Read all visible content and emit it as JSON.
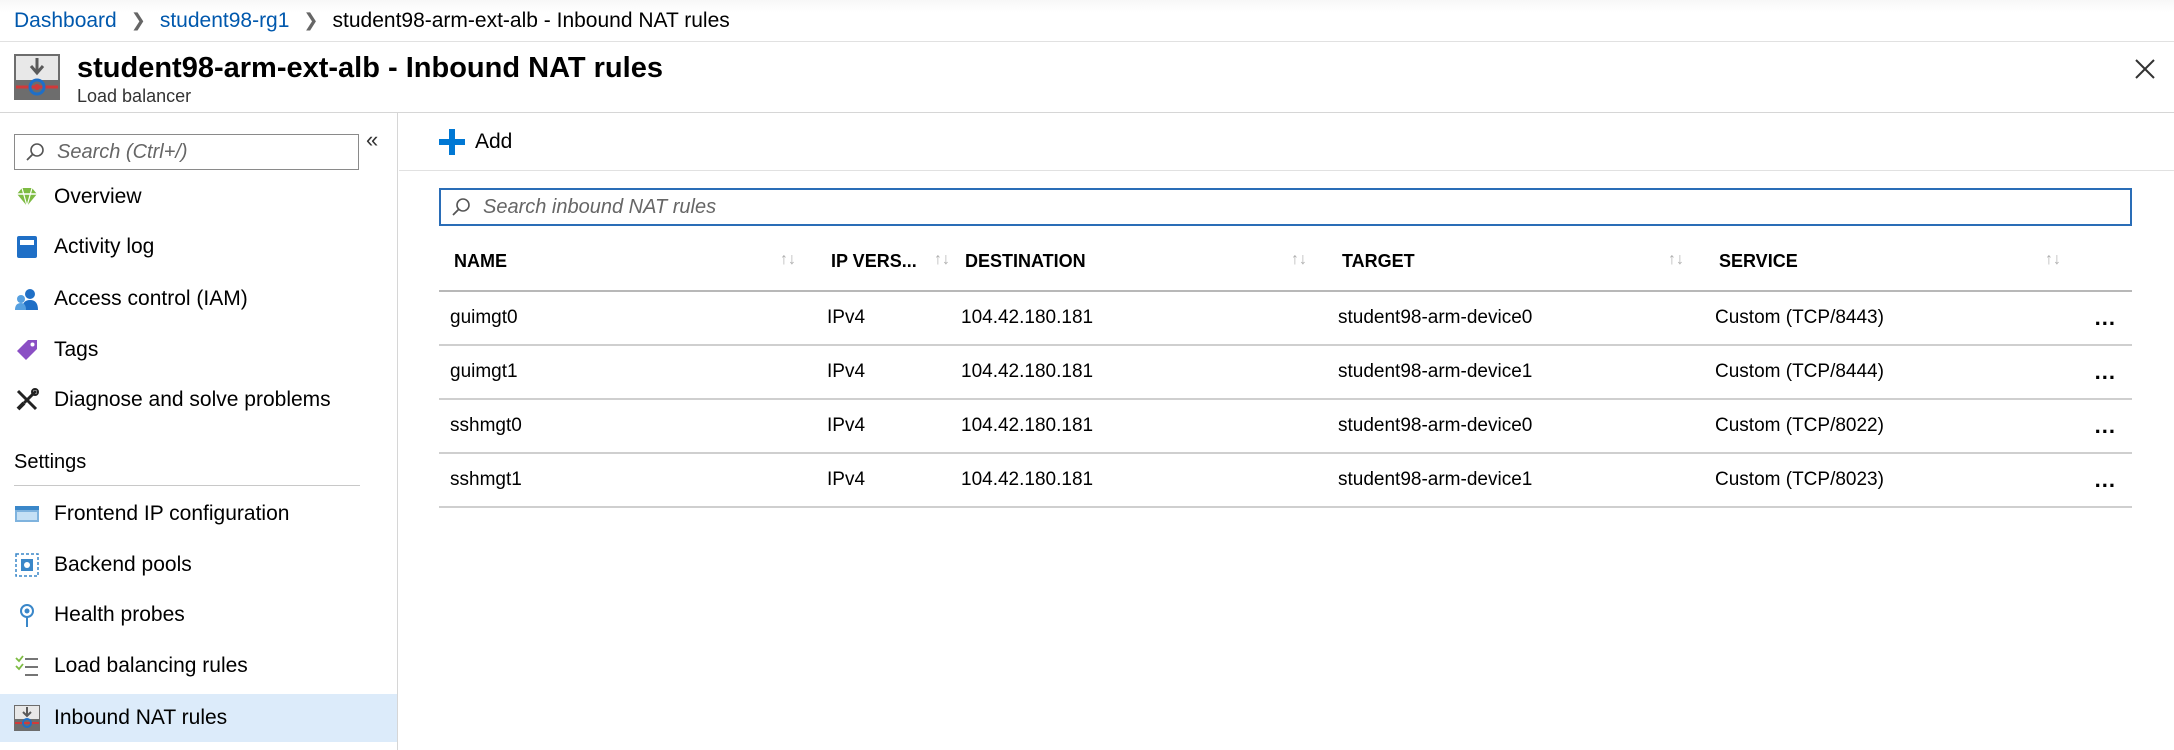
{
  "breadcrumb": {
    "items": [
      "Dashboard",
      "student98-rg1"
    ],
    "current": "student98-arm-ext-alb - Inbound NAT rules"
  },
  "header": {
    "title": "student98-arm-ext-alb - Inbound NAT rules",
    "subtitle": "Load balancer",
    "icon": "load-balancer-icon"
  },
  "sidebar": {
    "search_placeholder": "Search (Ctrl+/)",
    "collapse_glyph": "«",
    "items": [
      {
        "label": "Overview",
        "icon": "overview-icon"
      },
      {
        "label": "Activity log",
        "icon": "activity-log-icon"
      },
      {
        "label": "Access control (IAM)",
        "icon": "iam-icon"
      },
      {
        "label": "Tags",
        "icon": "tag-icon"
      },
      {
        "label": "Diagnose and solve problems",
        "icon": "wrench-icon"
      }
    ],
    "settings_label": "Settings",
    "settings_items": [
      {
        "label": "Frontend IP configuration",
        "icon": "frontend-ip-icon"
      },
      {
        "label": "Backend pools",
        "icon": "backend-pools-icon"
      },
      {
        "label": "Health probes",
        "icon": "health-probe-icon"
      },
      {
        "label": "Load balancing rules",
        "icon": "lb-rules-icon"
      },
      {
        "label": "Inbound NAT rules",
        "icon": "nat-rules-icon",
        "selected": true
      }
    ]
  },
  "toolbar": {
    "add_label": "Add"
  },
  "main": {
    "search_placeholder": "Search inbound NAT rules",
    "columns": [
      "NAME",
      "IP VERS...",
      "DESTINATION",
      "TARGET",
      "SERVICE"
    ],
    "sort_glyph": "↑↓",
    "more_glyph": "...",
    "rows": [
      {
        "name": "guimgt0",
        "ip_version": "IPv4",
        "destination": "104.42.180.181",
        "target": "student98-arm-device0",
        "service": "Custom (TCP/8443)"
      },
      {
        "name": "guimgt1",
        "ip_version": "IPv4",
        "destination": "104.42.180.181",
        "target": "student98-arm-device1",
        "service": "Custom (TCP/8444)"
      },
      {
        "name": "sshmgt0",
        "ip_version": "IPv4",
        "destination": "104.42.180.181",
        "target": "student98-arm-device0",
        "service": "Custom (TCP/8022)"
      },
      {
        "name": "sshmgt1",
        "ip_version": "IPv4",
        "destination": "104.42.180.181",
        "target": "student98-arm-device1",
        "service": "Custom (TCP/8023)"
      }
    ]
  },
  "colors": {
    "link": "#0058ad",
    "accent": "#0078d4",
    "selected_bg": "#dcebfa"
  }
}
